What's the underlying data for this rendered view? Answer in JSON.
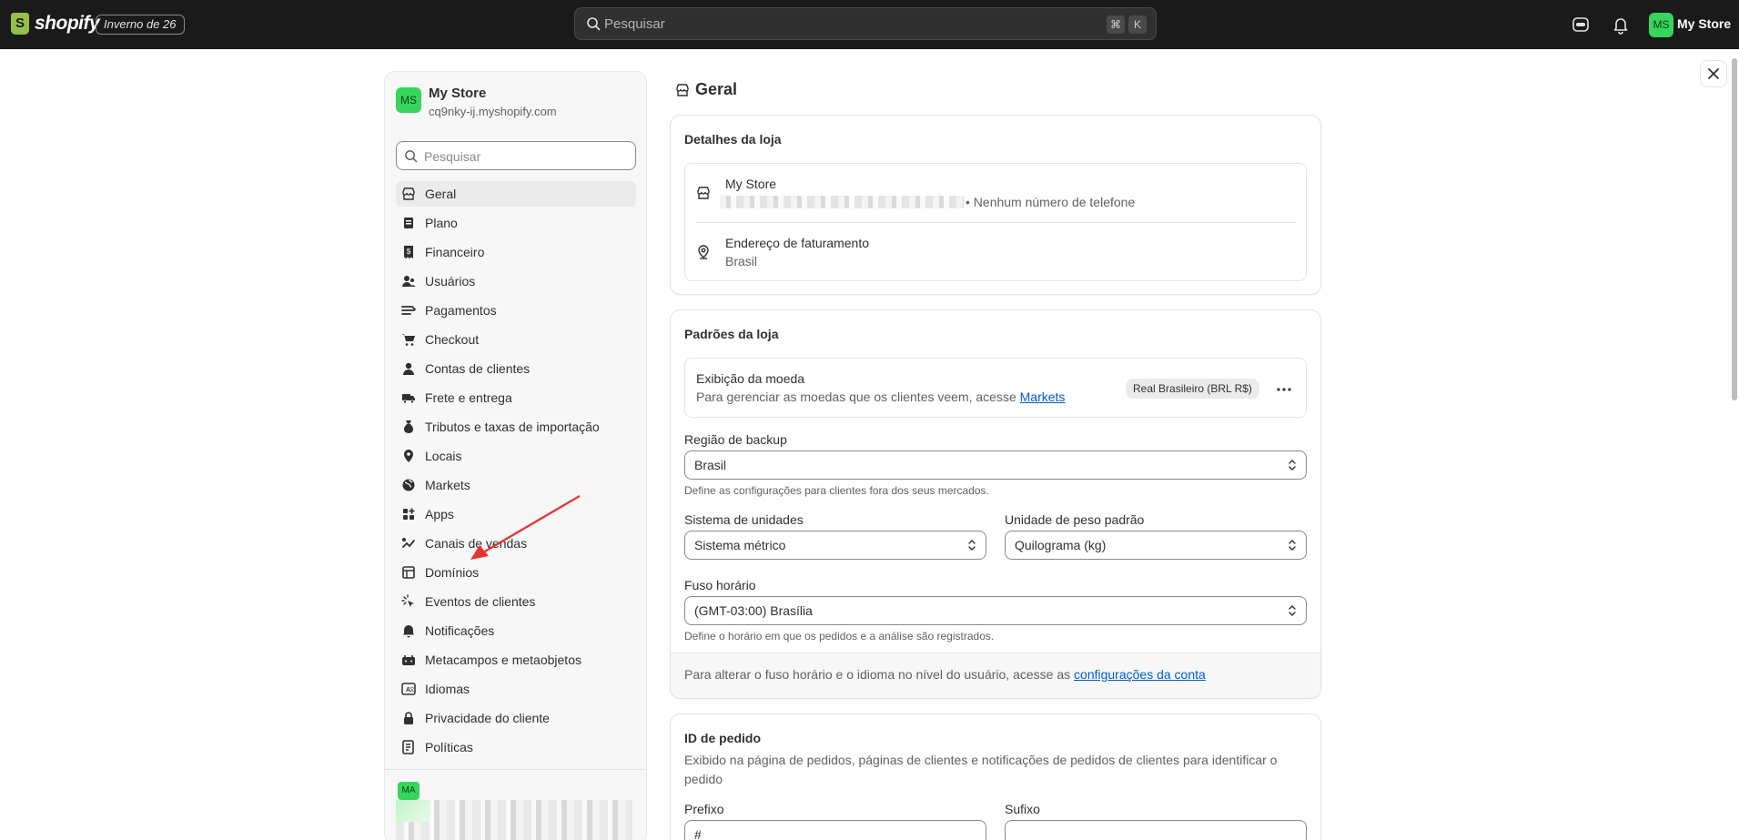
{
  "topbar": {
    "logo_text": "shopify",
    "edition": "Inverno de 26",
    "search_placeholder": "Pesquisar",
    "shortcut_cmd": "⌘",
    "shortcut_key": "K",
    "avatar_initials": "MS",
    "store_name": "My Store"
  },
  "sidebar": {
    "store_initials": "MS",
    "store_name": "My Store",
    "store_domain": "cq9nky-ij.myshopify.com",
    "search_placeholder": "Pesquisar",
    "items": [
      {
        "label": "Geral",
        "icon": "store-icon",
        "active": true
      },
      {
        "label": "Plano",
        "icon": "plan-icon"
      },
      {
        "label": "Financeiro",
        "icon": "receipt-icon"
      },
      {
        "label": "Usuários",
        "icon": "users-icon"
      },
      {
        "label": "Pagamentos",
        "icon": "payments-icon"
      },
      {
        "label": "Checkout",
        "icon": "cart-icon"
      },
      {
        "label": "Contas de clientes",
        "icon": "person-icon"
      },
      {
        "label": "Frete e entrega",
        "icon": "truck-icon"
      },
      {
        "label": "Tributos e taxas de importação",
        "icon": "tax-icon"
      },
      {
        "label": "Locais",
        "icon": "location-icon"
      },
      {
        "label": "Markets",
        "icon": "globe-icon"
      },
      {
        "label": "Apps",
        "icon": "apps-icon"
      },
      {
        "label": "Canais de vendas",
        "icon": "channels-icon"
      },
      {
        "label": "Domínios",
        "icon": "domain-icon"
      },
      {
        "label": "Eventos de clientes",
        "icon": "events-icon"
      },
      {
        "label": "Notificações",
        "icon": "bell-icon"
      },
      {
        "label": "Metacampos e metaobjetos",
        "icon": "metafields-icon"
      },
      {
        "label": "Idiomas",
        "icon": "language-icon"
      },
      {
        "label": "Privacidade do cliente",
        "icon": "lock-icon"
      },
      {
        "label": "Políticas",
        "icon": "policy-icon"
      }
    ],
    "user_initials": "MA"
  },
  "page": {
    "title": "Geral"
  },
  "store_details": {
    "title": "Detalhes da loja",
    "store_name": "My Store",
    "phone": "• Nenhum número de telefone",
    "billing_title": "Endereço de faturamento",
    "billing_country": "Brasil"
  },
  "store_defaults": {
    "title": "Padrões da loja",
    "currency_title": "Exibição da moeda",
    "currency_desc": "Para gerenciar as moedas que os clientes veem, acesse",
    "currency_link": "Markets",
    "currency_badge": "Real Brasileiro (BRL R$)",
    "backup_label": "Região de backup",
    "backup_value": "Brasil",
    "backup_help": "Define as configurações para clientes fora dos seus mercados.",
    "units_label": "Sistema de unidades",
    "units_value": "Sistema métrico",
    "weight_label": "Unidade de peso padrão",
    "weight_value": "Quilograma (kg)",
    "tz_label": "Fuso horário",
    "tz_value": "(GMT-03:00) Brasília",
    "tz_help": "Define o horário em que os pedidos e a análise são registrados.",
    "footer_text": "Para alterar o fuso horário e o idioma no nível do usuário, acesse as",
    "footer_link": "configurações da conta"
  },
  "order_id": {
    "title": "ID de pedido",
    "desc": "Exibido na página de pedidos, páginas de clientes e notificações de pedidos de clientes para identificar o pedido",
    "prefix_label": "Prefixo",
    "prefix_value": "#",
    "suffix_label": "Sufixo",
    "suffix_value": ""
  }
}
